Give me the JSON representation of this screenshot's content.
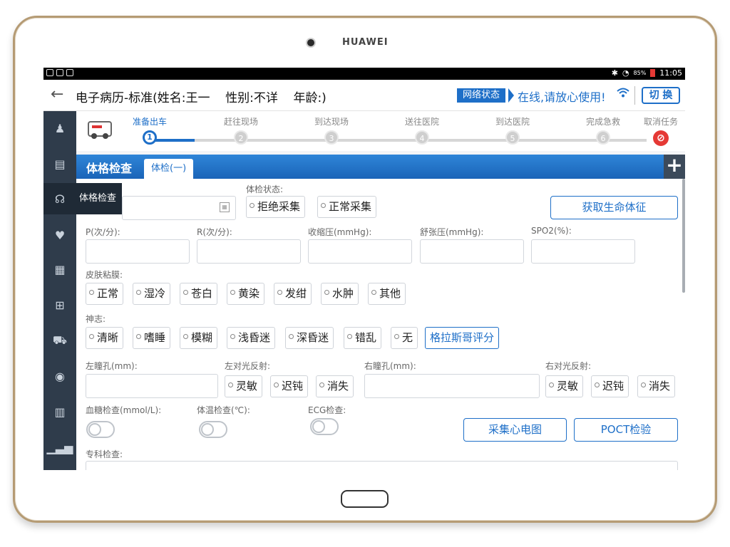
{
  "device": {
    "brand": "HUAWEI"
  },
  "statusbar": {
    "time": "11:05",
    "battery": "85%"
  },
  "header": {
    "title": "电子病历-标准(姓名:王一    性别:不详    年龄:)",
    "network_label": "网络状态",
    "network_status": "在线,请放心使用!",
    "switch_label": "切 换"
  },
  "progress": {
    "steps": [
      {
        "label": "准备出车",
        "num": "1",
        "state": "active"
      },
      {
        "label": "赶往现场",
        "num": "2",
        "state": "pending"
      },
      {
        "label": "到达现场",
        "num": "3",
        "state": "pending"
      },
      {
        "label": "送往医院",
        "num": "4",
        "state": "pending"
      },
      {
        "label": "到达医院",
        "num": "5",
        "state": "pending"
      },
      {
        "label": "完成急救",
        "num": "6",
        "state": "pending"
      }
    ],
    "cancel_label": "取消任务"
  },
  "sidebar": {
    "items": [
      {
        "icon": "person-icon"
      },
      {
        "icon": "clipboard-icon"
      },
      {
        "icon": "stethoscope-icon",
        "tooltip": "体格检查"
      },
      {
        "icon": "heart-rate-icon"
      },
      {
        "icon": "document-icon"
      },
      {
        "icon": "medical-plus-icon"
      },
      {
        "icon": "ambulance-car-icon"
      },
      {
        "icon": "user-circle-icon"
      },
      {
        "icon": "report-icon"
      },
      {
        "icon": "chart-icon"
      }
    ]
  },
  "section": {
    "title": "体格检查",
    "tab": "体检(一)",
    "add": "+"
  },
  "form": {
    "exam_state_label": "体检状态:",
    "exam_state_options": [
      "拒绝采集",
      "正常采集"
    ],
    "get_vitals_button": "获取生命体征",
    "vitals_labels": [
      "P(次/分):",
      "R(次/分):",
      "收缩压(mmHg):",
      "舒张压(mmHg):",
      "SPO2(%):"
    ],
    "skin_label": "皮肤粘膜:",
    "skin_options": [
      "正常",
      "湿冷",
      "苍白",
      "黄染",
      "发绀",
      "水肿",
      "其他"
    ],
    "mind_label": "神志:",
    "mind_options": [
      "清晰",
      "嗜睡",
      "模糊",
      "浅昏迷",
      "深昏迷",
      "错乱",
      "无"
    ],
    "gcs_button": "格拉斯哥评分",
    "left_pupil_label": "左瞳孔(mm):",
    "left_reflex_label": "左对光反射:",
    "right_pupil_label": "右瞳孔(mm):",
    "right_reflex_label": "右对光反射:",
    "reflex_options": [
      "灵敏",
      "迟钝",
      "消失"
    ],
    "glucose_label": "血糖检查(mmol/L):",
    "temp_label": "体温检查(℃):",
    "ecg_label": "ECG检查:",
    "ecg_button": "采集心电图",
    "poct_button": "POCT检验",
    "special_label": "专科检查:"
  }
}
